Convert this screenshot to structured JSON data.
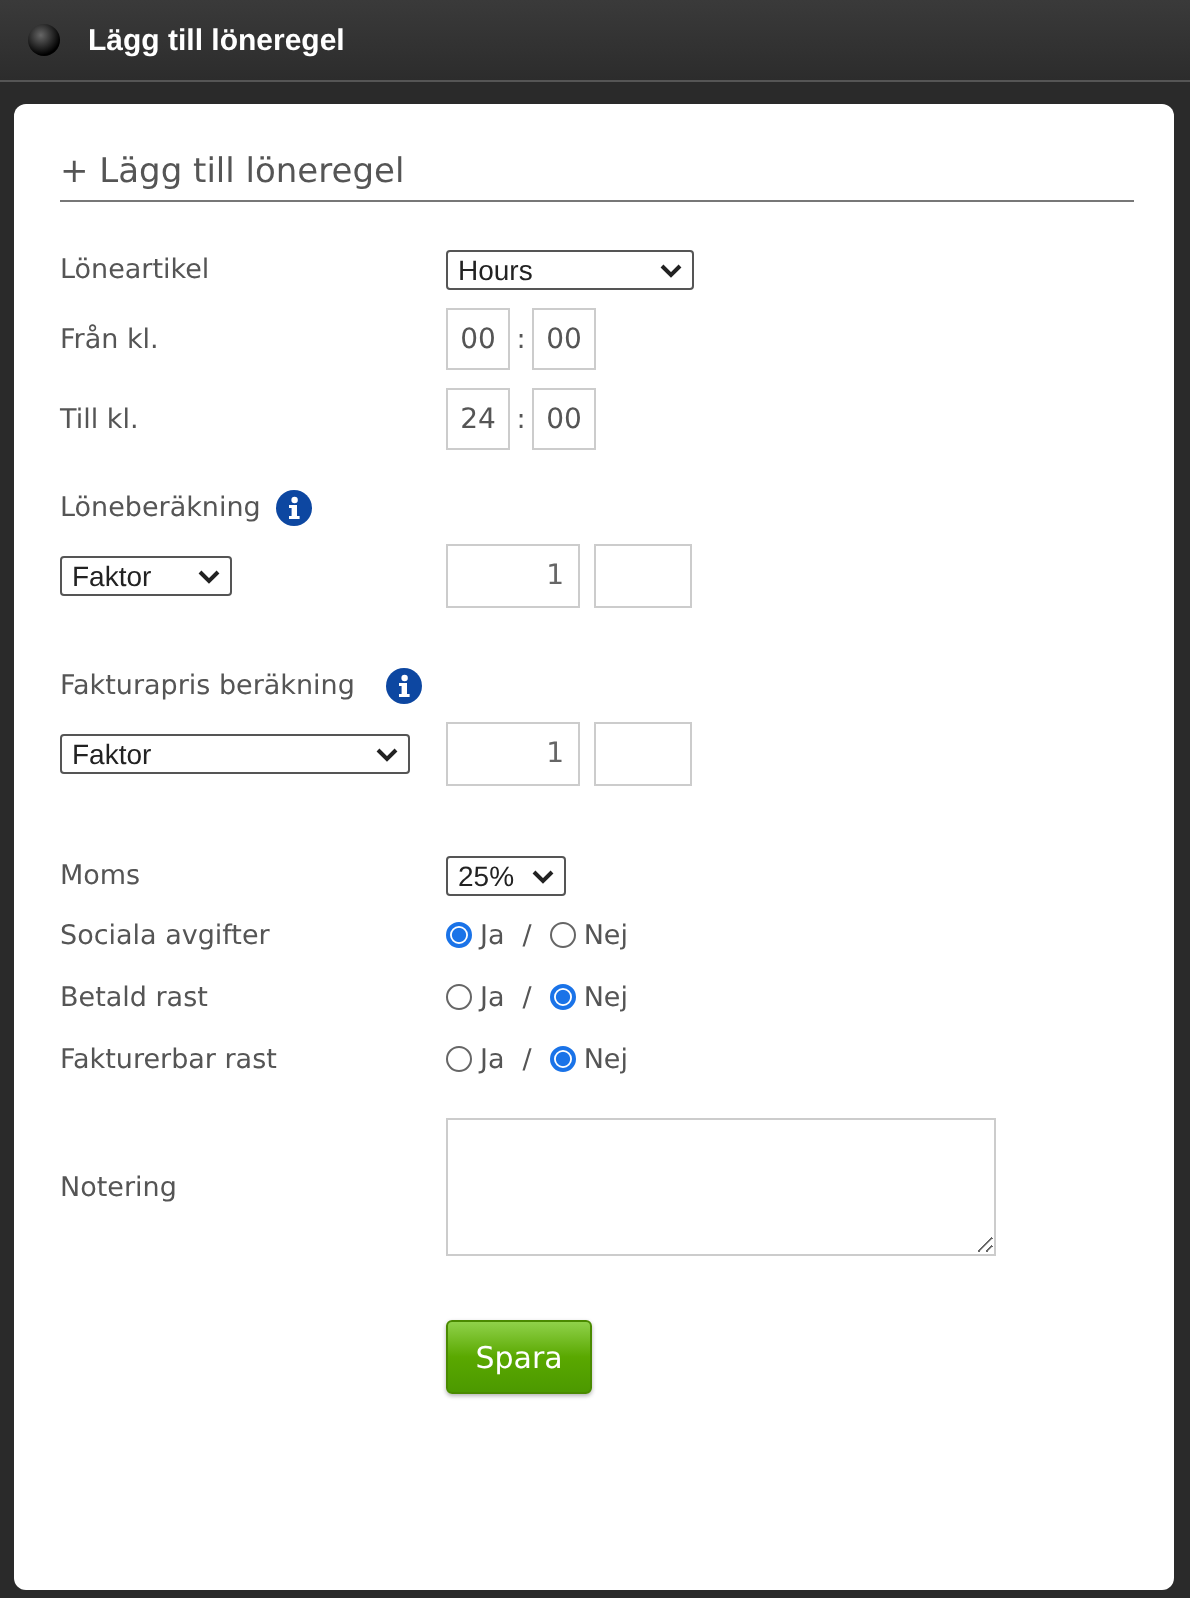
{
  "window": {
    "title": "Lägg till löneregel"
  },
  "heading": "+ Lägg till löneregel",
  "pay_article": {
    "label": "Löneartikel",
    "value": "Hours"
  },
  "from_time": {
    "label": "Från kl.",
    "hours": "00",
    "separator": ":",
    "minutes": "00"
  },
  "to_time": {
    "label": "Till kl.",
    "hours": "24",
    "separator": ":",
    "minutes": "00"
  },
  "pay_calculation": {
    "label": "Löneberäkning",
    "method": "Faktor",
    "factor": "1"
  },
  "invoice_calculation": {
    "label": "Fakturapris beräkning",
    "method": "Faktor",
    "factor": "1"
  },
  "vat": {
    "label": "Moms",
    "value": "25%"
  },
  "options": [
    {
      "label": "Sociala avgifter",
      "separator": "/",
      "choices": [
        {
          "label": "Ja",
          "selected": true
        },
        {
          "label": "Nej",
          "selected": false
        }
      ]
    },
    {
      "label": "Betald rast",
      "separator": "/",
      "choices": [
        {
          "label": "Ja",
          "selected": false
        },
        {
          "label": "Nej",
          "selected": true
        }
      ]
    },
    {
      "label": "Fakturerbar rast",
      "separator": "/",
      "choices": [
        {
          "label": "Ja",
          "selected": false
        },
        {
          "label": "Nej",
          "selected": true
        }
      ]
    }
  ],
  "note": {
    "label": "Notering"
  },
  "save_button": "Spara"
}
